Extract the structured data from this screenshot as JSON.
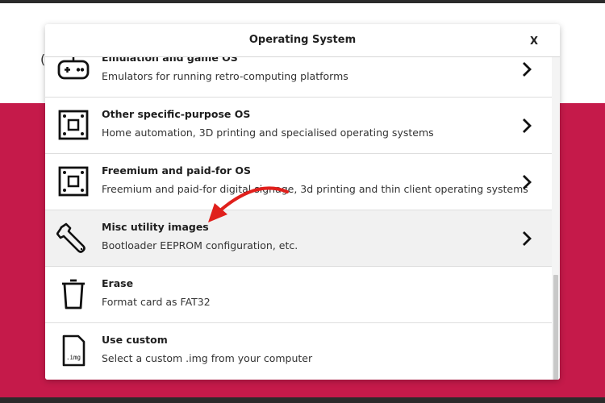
{
  "dialog": {
    "title": "Operating System",
    "close_label": "X"
  },
  "behind_glyph": "(",
  "items": [
    {
      "title": "Emulation and game OS",
      "desc": "Emulators for running retro-computing platforms",
      "icon": "gamepad-icon"
    },
    {
      "title": "Other specific-purpose OS",
      "desc": "Home automation, 3D printing and specialised operating systems",
      "icon": "board-icon"
    },
    {
      "title": "Freemium and paid-for OS",
      "desc": "Freemium and paid-for digital signage, 3d printing and thin client operating systems",
      "icon": "board-icon"
    },
    {
      "title": "Misc utility images",
      "desc": "Bootloader EEPROM configuration, etc.",
      "icon": "wrench-icon"
    },
    {
      "title": "Erase",
      "desc": "Format card as FAT32",
      "icon": "trash-icon"
    },
    {
      "title": "Use custom",
      "desc": "Select a custom .img from your computer",
      "icon": "file-img-icon",
      "icon_text": ".img"
    }
  ],
  "colors": {
    "background_accent": "#c51a4a",
    "annotation_arrow": "#e0201c"
  }
}
